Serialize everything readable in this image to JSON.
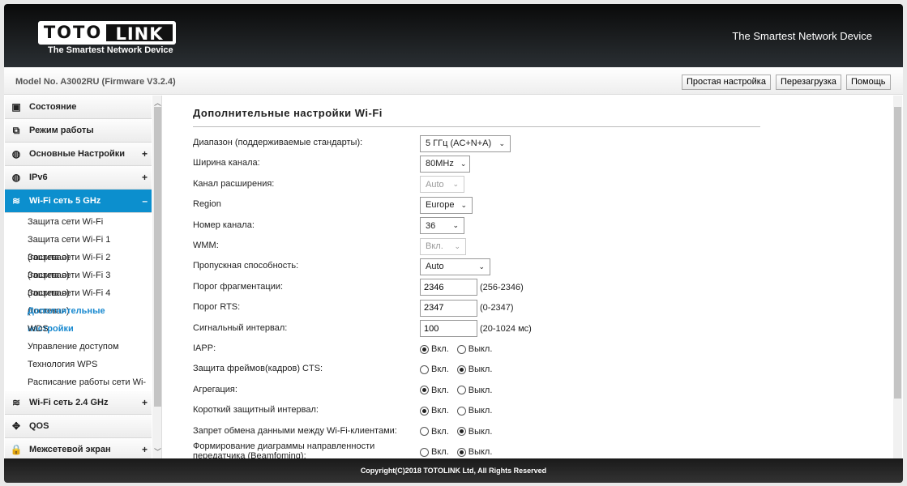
{
  "header": {
    "logo_left": "TOTO",
    "logo_right": "LINK",
    "logo_tagline": "The Smartest Network Device",
    "tagline": "The Smartest Network Device"
  },
  "model": "Model No. A3002RU (Firmware V3.2.4)",
  "toolbar": {
    "easy_setup": "Простая настройка",
    "reboot": "Перезагрузка",
    "help": "Помощь"
  },
  "sidebar": {
    "top": [
      {
        "label": "Состояние",
        "icon": "chat-icon"
      },
      {
        "label": "Режим работы",
        "icon": "windows-icon"
      },
      {
        "label": "Основные Настройки",
        "icon": "globe-icon",
        "expander": "+"
      },
      {
        "label": "IPv6",
        "icon": "globe-icon",
        "expander": "+"
      },
      {
        "label": "Wi-Fi сеть 5 GHz",
        "icon": "wifi-icon",
        "expander": "–"
      }
    ],
    "sub": [
      "Защита сети Wi-Fi",
      "Защита сети Wi-Fi 1 (гостевая)",
      "Защита сети Wi-Fi 2 (гостевая)",
      "Защита сети Wi-Fi 3 (гостевая)",
      "Защита сети Wi-Fi 4 (гостевая)",
      "Дополнительные настройки",
      "WDS",
      "Управление доступом",
      "Технология WPS",
      "Расписание работы сети Wi-Fi"
    ],
    "bottom": [
      {
        "label": "Wi-Fi сеть 2.4 GHz",
        "icon": "wifi-icon",
        "expander": "+"
      },
      {
        "label": "QOS",
        "icon": "qos-icon"
      },
      {
        "label": "Межсетевой экран",
        "icon": "lock-icon",
        "expander": "+"
      }
    ]
  },
  "main": {
    "title": "Дополнительные настройки Wi-Fi",
    "fields": [
      {
        "label": "Диапазон (поддерживаемые стандарты):",
        "value": "5 ГГц (AC+N+A)"
      },
      {
        "label": "Ширина канала:",
        "value": "80MHz"
      },
      {
        "label": "Канал расширения:",
        "value": "Auto"
      },
      {
        "label": "Region",
        "value": "Europe"
      },
      {
        "label": "Номер канала:",
        "value": "36"
      },
      {
        "label": "WMM:",
        "value": "Вкл."
      },
      {
        "label": "Пропускная способность:",
        "value": "Auto"
      },
      {
        "label": "Порог фрагментации:",
        "value": "2346",
        "hint": "(256-2346)"
      },
      {
        "label": "Порог RTS:",
        "value": "2347",
        "hint": "(0-2347)"
      },
      {
        "label": "Сигнальный интервал:",
        "value": "100",
        "hint": "(20-1024 мс)"
      },
      {
        "label": "IAPP:",
        "selected": "on"
      },
      {
        "label": "Защита фреймов(кадров) CTS:",
        "selected": "off"
      },
      {
        "label": "Агрегация:",
        "selected": "on"
      },
      {
        "label": "Короткий защитный интервал:",
        "selected": "on"
      },
      {
        "label": "Запрет обмена данными между Wi-Fi-клиентами:",
        "selected": "off"
      },
      {
        "label": "Формирование диаграммы направленности передатчика (Beamfoming):",
        "selected": "off"
      }
    ],
    "on_label": "Вкл.",
    "off_label": "Выкл."
  },
  "footer": "Copyright(C)2018 TOTOLINK Ltd, All Rights Reserved",
  "colors": {
    "accent": "#0c8fce",
    "active_link": "#1a8ad0"
  }
}
